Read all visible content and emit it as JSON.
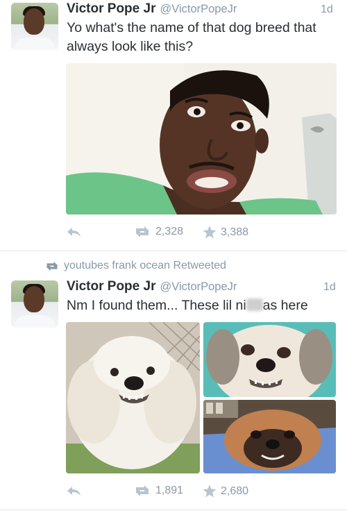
{
  "tweets": [
    {
      "author_name": "Victor Pope Jr",
      "handle": "@VictorPopeJr",
      "time": "1d",
      "text": "Yo what's the name of that dog breed that always look like this?",
      "retweets": "2,328",
      "likes": "3,388"
    },
    {
      "retweeted_by": "youtubes frank ocean Retweeted",
      "author_name": "Victor Pope Jr",
      "handle": "@VictorPopeJr",
      "time": "1d",
      "text_before": "Nm I found them... These lil ni",
      "text_after": "as here",
      "retweets": "1,891",
      "likes": "2,680"
    }
  ],
  "icons": {
    "reply": "reply-icon",
    "retweet": "retweet-icon",
    "like": "star-icon"
  },
  "colors": {
    "text": "#292f33",
    "muted": "#8899a6",
    "divider": "#e1e8ed"
  }
}
